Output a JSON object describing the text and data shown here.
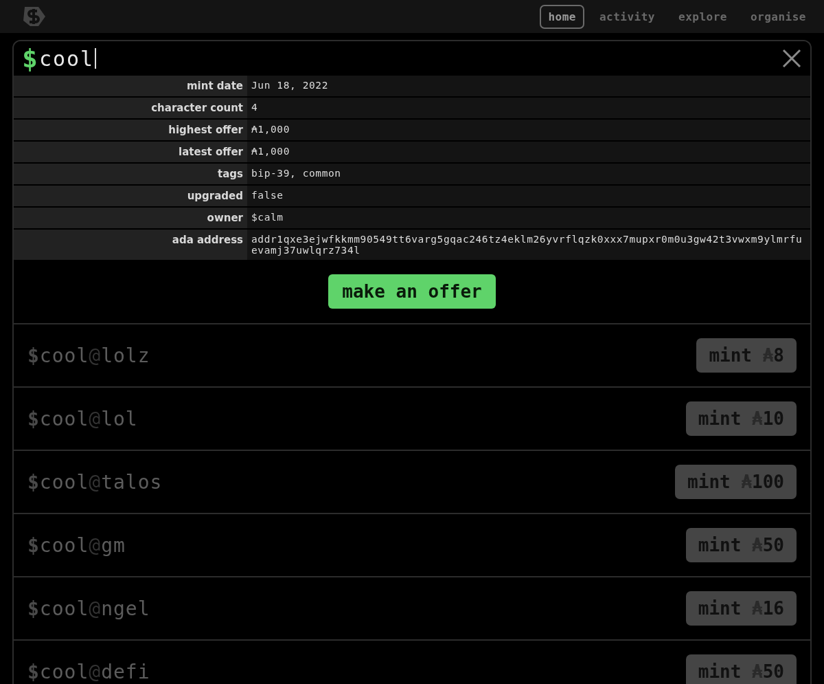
{
  "nav": {
    "tabs": [
      {
        "label": "home",
        "selected": true
      },
      {
        "label": "activity",
        "selected": false
      },
      {
        "label": "explore",
        "selected": false
      },
      {
        "label": "organise",
        "selected": false
      }
    ]
  },
  "search": {
    "sigil": "$",
    "value": "cool"
  },
  "details": [
    {
      "label": "mint date",
      "value": "Jun 18, 2022"
    },
    {
      "label": "character count",
      "value": "4"
    },
    {
      "label": "highest offer",
      "value": "₳1,000"
    },
    {
      "label": "latest offer",
      "value": "₳1,000"
    },
    {
      "label": "tags",
      "value": "bip-39, common"
    },
    {
      "label": "upgraded",
      "value": "false"
    },
    {
      "label": "owner",
      "value": "$calm"
    },
    {
      "label": "ada address",
      "value": "addr1qxe3ejwfkkmm90549tt6varg5gqac246tz4eklm26yvrflqzk0xxx7mupxr0m0u3gw42t3vwxm9ylmrfuevamj37uwlqrz734l"
    }
  ],
  "offer_button": "make an offer",
  "handles": [
    {
      "sigil": "$",
      "name": "cool",
      "at": "@",
      "sub": "lolz",
      "action": "mint",
      "currency": "₳",
      "amount": "8"
    },
    {
      "sigil": "$",
      "name": "cool",
      "at": "@",
      "sub": "lol",
      "action": "mint",
      "currency": "₳",
      "amount": "10"
    },
    {
      "sigil": "$",
      "name": "cool",
      "at": "@",
      "sub": "talos",
      "action": "mint",
      "currency": "₳",
      "amount": "100"
    },
    {
      "sigil": "$",
      "name": "cool",
      "at": "@",
      "sub": "gm",
      "action": "mint",
      "currency": "₳",
      "amount": "50"
    },
    {
      "sigil": "$",
      "name": "cool",
      "at": "@",
      "sub": "ngel",
      "action": "mint",
      "currency": "₳",
      "amount": "16"
    },
    {
      "sigil": "$",
      "name": "cool",
      "at": "@",
      "sub": "defi",
      "action": "mint",
      "currency": "₳",
      "amount": "50"
    }
  ]
}
